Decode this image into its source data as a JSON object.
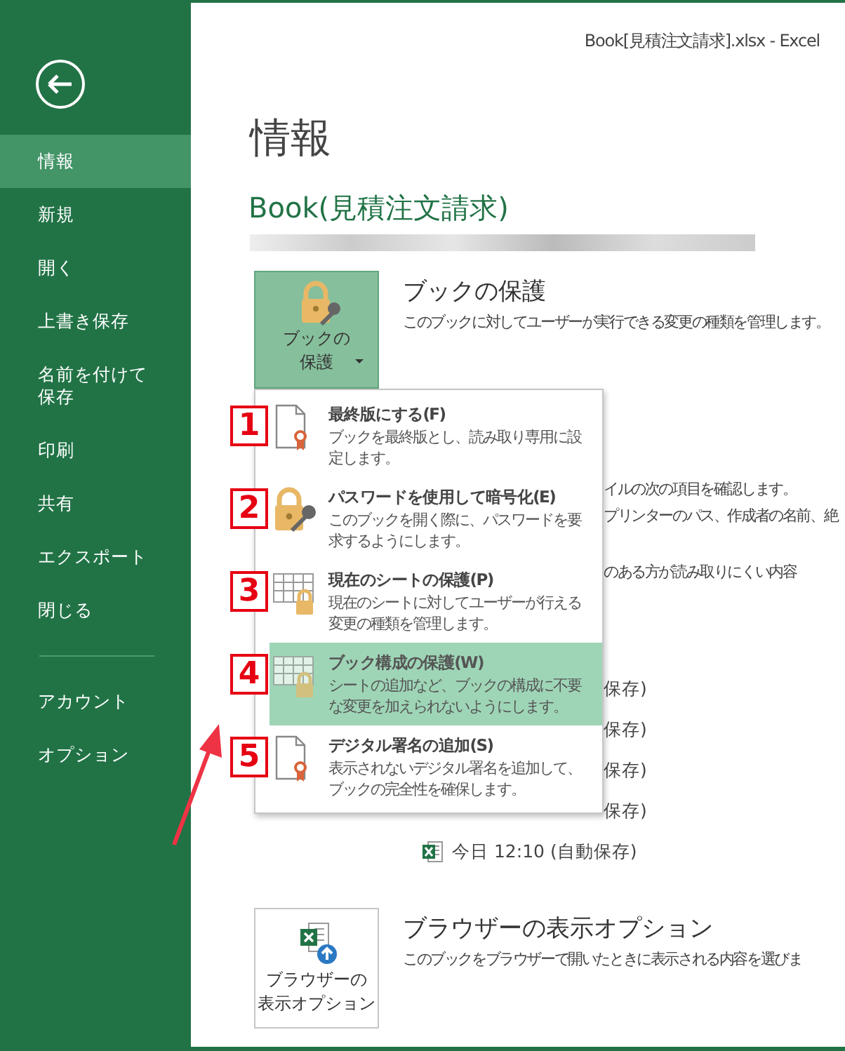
{
  "window": {
    "title": "Book[見積注文請求].xlsx - Excel"
  },
  "sidebar": {
    "items": [
      {
        "label": "情報",
        "selected": true
      },
      {
        "label": "新規",
        "selected": false
      },
      {
        "label": "開く",
        "selected": false
      },
      {
        "label": "上書き保存",
        "selected": false
      },
      {
        "label": "名前を付けて保存",
        "selected": false
      },
      {
        "label": "印刷",
        "selected": false
      },
      {
        "label": "共有",
        "selected": false
      },
      {
        "label": "エクスポート",
        "selected": false
      },
      {
        "label": "閉じる",
        "selected": false
      }
    ],
    "bottom_items": [
      {
        "label": "アカウント",
        "selected": false
      },
      {
        "label": "オプション",
        "selected": false
      }
    ]
  },
  "page_title": "情報",
  "book_title": "Book(見積注文請求)",
  "protect": {
    "button_lines": [
      "ブックの",
      "保護"
    ],
    "heading": "ブックの保護",
    "description": "このブックに対してユーザーが実行できる変更の種類を管理します。"
  },
  "protect_menu": {
    "items": [
      {
        "number": "1",
        "kind": "document-ribbon",
        "title": "最終版にする(F)",
        "description": "ブックを最終版とし、読み取り専用に設定します。",
        "selected": false
      },
      {
        "number": "2",
        "kind": "lock-key",
        "title": "パスワードを使用して暗号化(E)",
        "description": "このブックを開く際に、パスワードを要求するようにします。",
        "selected": false
      },
      {
        "number": "3",
        "kind": "sheet-lock",
        "title": "現在のシートの保護(P)",
        "description": "現在のシートに対してユーザーが行える変更の種類を管理します。",
        "selected": false
      },
      {
        "number": "4",
        "kind": "sheet-lock",
        "title": "ブック構成の保護(W)",
        "description": "シートの追加など、ブックの構成に不要な変更を加えられないようにします。",
        "selected": true
      },
      {
        "number": "5",
        "kind": "document-ribbon",
        "title": "デジタル署名の追加(S)",
        "description": "表示されないデジタル署名を追加して、ブックの完全性を確保します。",
        "selected": false
      }
    ]
  },
  "inspect_lines": [
    "イルの次の項目を確認します。",
    "プリンターのパス、作成者の名前、絶",
    "のある方が読み取りにくい内容"
  ],
  "versions": [
    {
      "text": "保存)",
      "has_icon": false
    },
    {
      "text": "保存)",
      "has_icon": false
    },
    {
      "text": "保存)",
      "has_icon": false
    },
    {
      "text": "保存)",
      "has_icon": false
    },
    {
      "text": "今日 12:10 (自動保存)",
      "has_icon": true
    }
  ],
  "browser_options": {
    "button_lines": [
      "ブラウザーの",
      "表示オプション"
    ],
    "heading": "ブラウザーの表示オプション",
    "description": "このブックをブラウザーで開いたときに表示される内容を選びま"
  }
}
